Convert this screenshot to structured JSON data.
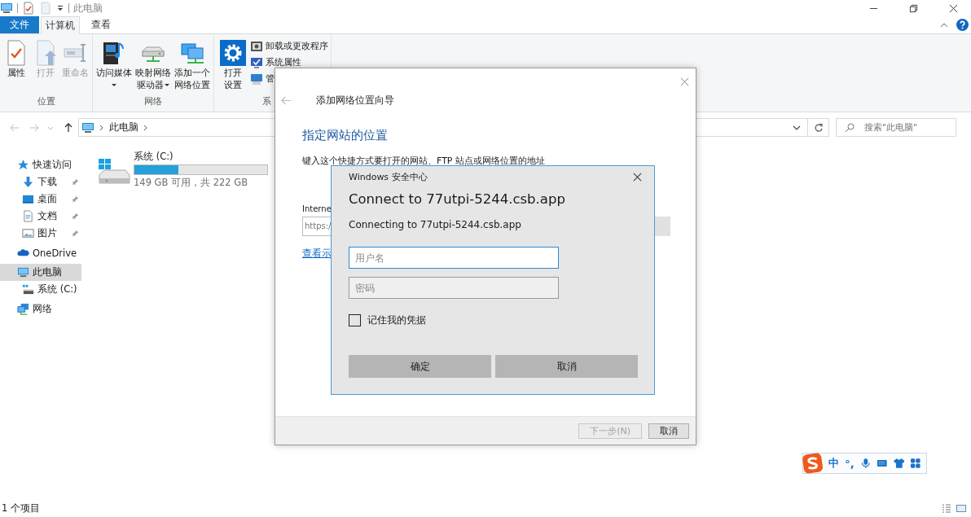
{
  "explorer": {
    "title": "此电脑",
    "tabs": [
      {
        "label": "文件",
        "kind": "file",
        "selected": false
      },
      {
        "label": "计算机",
        "kind": "tab",
        "selected": true
      },
      {
        "label": "查看",
        "kind": "tab",
        "selected": false
      }
    ],
    "ribbon": [
      {
        "label": "位置",
        "commands": [
          {
            "kind": "properties",
            "lines": [
              "属性"
            ],
            "disabled": false,
            "has_menu": false
          },
          {
            "kind": "open",
            "lines": [
              "打开"
            ],
            "disabled": true,
            "has_menu": false
          },
          {
            "kind": "rename",
            "lines": [
              "重命名"
            ],
            "disabled": true,
            "has_menu": false
          }
        ]
      },
      {
        "label": "网络",
        "commands": [
          {
            "kind": "media",
            "lines": [
              "访问媒体"
            ],
            "disabled": false,
            "has_menu": true
          },
          {
            "kind": "map-drive",
            "lines": [
              "映射网络",
              "驱动器"
            ],
            "disabled": false,
            "has_menu": true
          },
          {
            "kind": "network-location",
            "lines": [
              "添加一个",
              "网络位置"
            ],
            "disabled": false,
            "has_menu": false
          }
        ]
      },
      {
        "label": "系",
        "commands": [
          {
            "kind": "settings",
            "lines": [
              "打开",
              "设置"
            ],
            "disabled": false,
            "has_menu": false
          }
        ],
        "small_commands": [
          {
            "kind": "uninstall",
            "label": "卸载或更改程序"
          },
          {
            "kind": "system-properties",
            "label": "系统属性"
          },
          {
            "kind": "manage",
            "label": "管"
          }
        ]
      }
    ],
    "address": {
      "location": "此电脑"
    },
    "search": {
      "placeholder": "搜索\"此电脑\""
    },
    "nav_pane": [
      {
        "label": "快速访问",
        "kind": "star",
        "selected": false,
        "children": [
          {
            "label": "下载",
            "kind": "download",
            "selected": false,
            "pinned": true
          },
          {
            "label": "桌面",
            "kind": "desktop",
            "selected": false,
            "pinned": true
          },
          {
            "label": "文档",
            "kind": "document",
            "selected": false,
            "pinned": true
          },
          {
            "label": "图片",
            "kind": "picture",
            "selected": false,
            "pinned": true
          }
        ]
      },
      {
        "label": "OneDrive",
        "kind": "cloud",
        "selected": false
      },
      {
        "label": "此电脑",
        "kind": "pc",
        "selected": true,
        "children": [
          {
            "label": "系统 (C:)",
            "kind": "drive",
            "selected": false
          }
        ]
      },
      {
        "label": "网络",
        "kind": "network",
        "selected": false
      }
    ],
    "drives": [
      {
        "name": "系统 (C:)",
        "level": 0.33,
        "caption": "149 GB 可用，共 222 GB"
      }
    ],
    "status_bar": {
      "count": "1 个项目"
    }
  },
  "wizard": {
    "title": "添加网络位置向导",
    "heading": "指定网站的位置",
    "instruction": "键入这个快捷方式要打开的网站、FTP 站点或网络位置的地址",
    "field_label": "Interne",
    "field_value": "https:/",
    "link": "查看示",
    "buttons": [
      {
        "label": "下一步(N)",
        "disabled": true
      },
      {
        "label": "取消",
        "disabled": false
      }
    ]
  },
  "security_dialog": {
    "caption": "Windows 安全中心",
    "title": "Connect to 77utpi-5244.csb.app",
    "message": "Connecting to 77utpi-5244.csb.app",
    "fields": [
      {
        "placeholder": "用户名",
        "focused": true
      },
      {
        "placeholder": "密码",
        "focused": false
      }
    ],
    "remember": {
      "label": "记住我的凭据",
      "checked": false
    },
    "buttons": [
      "确定",
      "取消"
    ]
  },
  "ime_toolbar": {
    "mode": "中",
    "punctuation": "°,"
  }
}
